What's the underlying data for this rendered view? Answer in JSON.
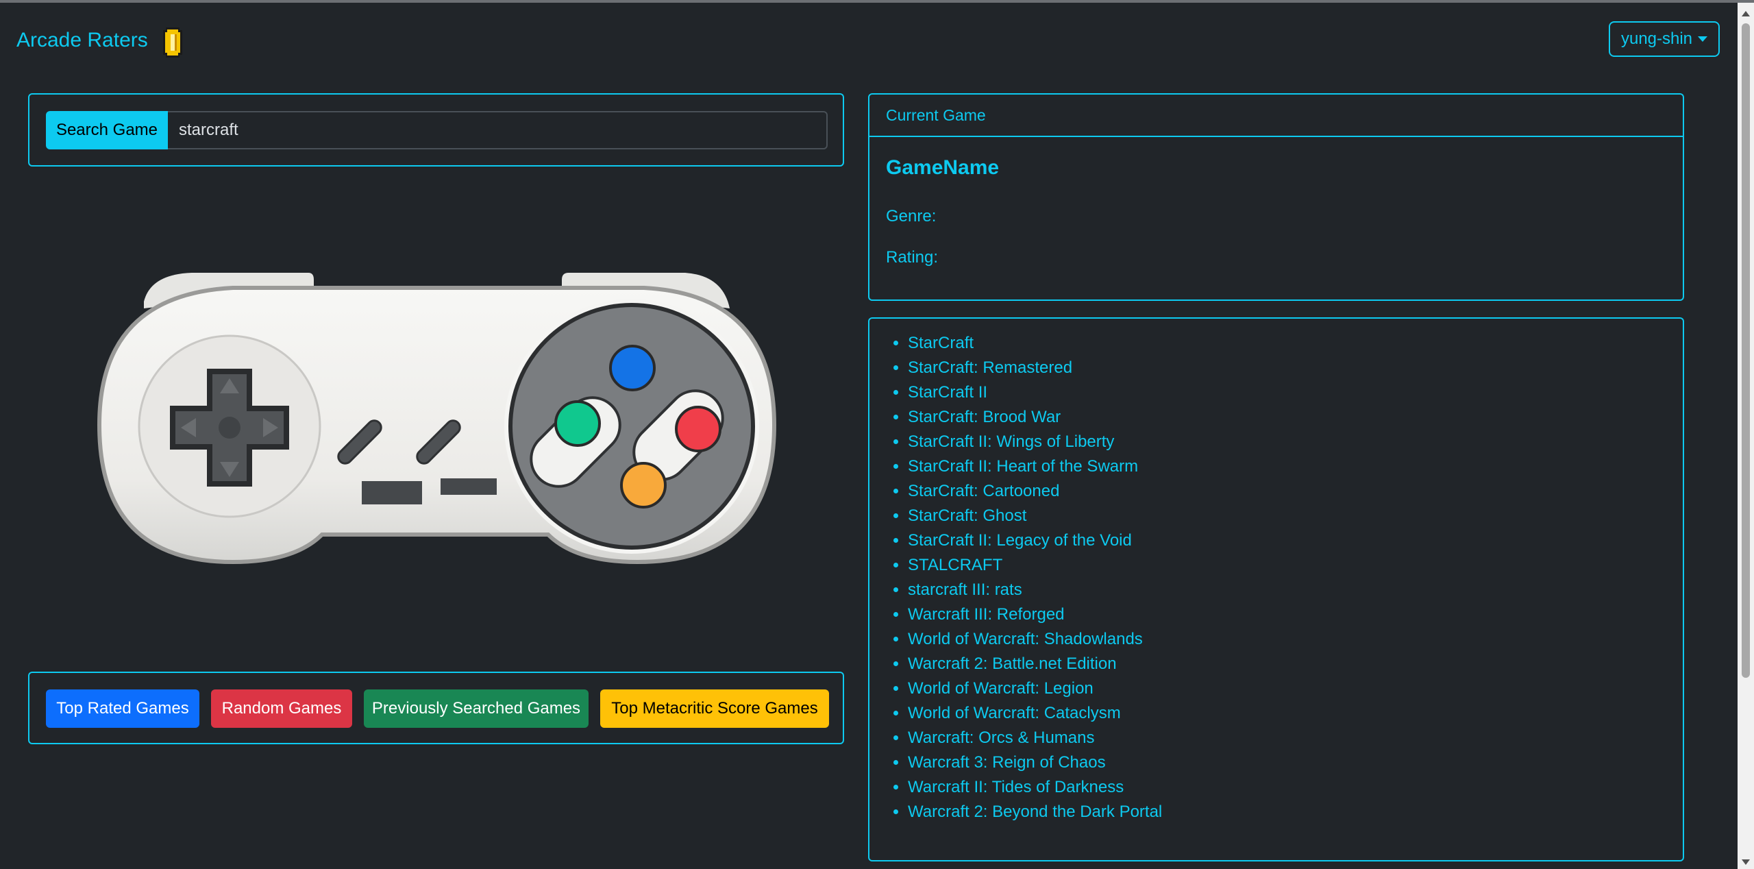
{
  "navbar": {
    "brand": "Arcade Raters",
    "user": "yung-shin"
  },
  "search": {
    "button_label": "Search Game",
    "value": "starcraft"
  },
  "actions": {
    "top_rated": "Top Rated Games",
    "random": "Random Games",
    "previously_searched": "Previously Searched Games",
    "top_metacritic": "Top Metacritic Score Games"
  },
  "current_game": {
    "header": "Current Game",
    "name": "GameName",
    "genre_label": "Genre:",
    "rating_label": "Rating:"
  },
  "results": [
    "StarCraft",
    "StarCraft: Remastered",
    "StarCraft II",
    "StarCraft: Brood War",
    "StarCraft II: Wings of Liberty",
    "StarCraft II: Heart of the Swarm",
    "StarCraft: Cartooned",
    "StarCraft: Ghost",
    "StarCraft II: Legacy of the Void",
    "STALCRAFT",
    "starcraft III: rats",
    "Warcraft III: Reforged",
    "World of Warcraft: Shadowlands",
    "Warcraft 2: Battle.net Edition",
    "World of Warcraft: Legion",
    "World of Warcraft: Cataclysm",
    "Warcraft: Orcs & Humans",
    "Warcraft 3: Reign of Chaos",
    "Warcraft II: Tides of Darkness",
    "Warcraft 2: Beyond the Dark Portal"
  ],
  "colors": {
    "accent": "#0dcaf0",
    "background": "#212529",
    "primary": "#0d6efd",
    "danger": "#dc3545",
    "success": "#198754",
    "warning": "#ffc107"
  },
  "icons": {
    "coin": "coin-icon",
    "controller": "gamepad-illustration",
    "caret": "caret-down-icon"
  }
}
